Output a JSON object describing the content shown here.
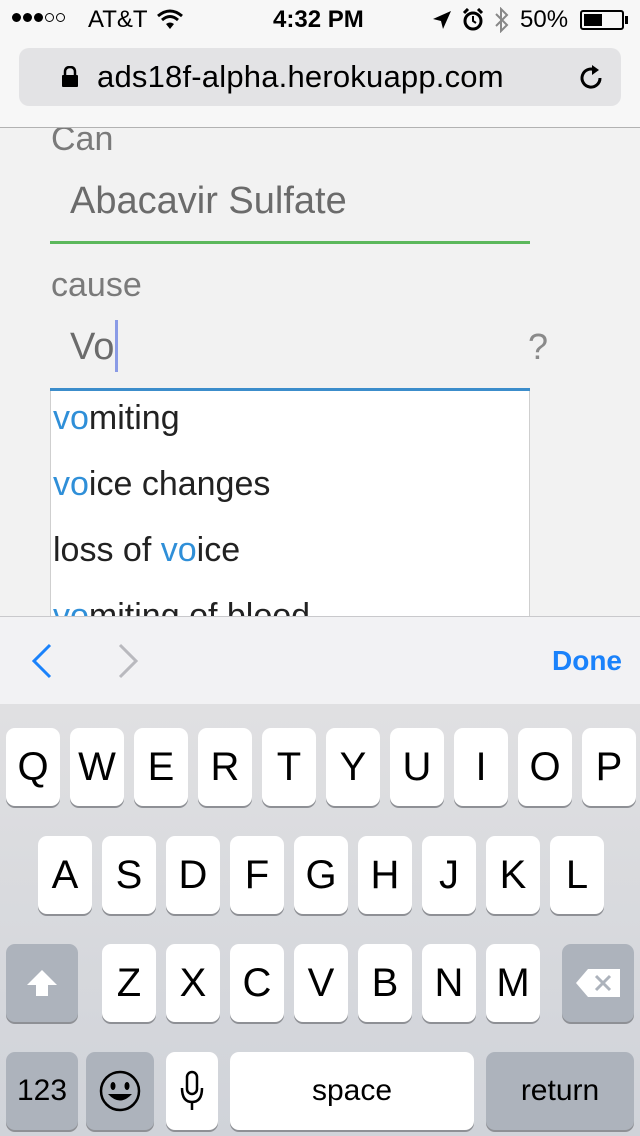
{
  "status_bar": {
    "carrier": "AT&T",
    "time": "4:32 PM",
    "battery": "50%",
    "battery_level": 0.5
  },
  "browser": {
    "url": "ads18f-alpha.herokuapp.com"
  },
  "form": {
    "drug_label": "Can",
    "drug_value": "Abacavir Sulfate",
    "cause_label": "cause",
    "cause_value": "Vo",
    "help_mark": "?"
  },
  "suggestions": [
    {
      "before": "",
      "match": "vo",
      "after": "miting"
    },
    {
      "before": "",
      "match": "vo",
      "after": "ice changes"
    },
    {
      "before": "loss of ",
      "match": "vo",
      "after": "ice"
    },
    {
      "before": "",
      "match": "vo",
      "after": "miting of blood"
    }
  ],
  "accessory_bar": {
    "done_label": "Done"
  },
  "keyboard": {
    "row1": [
      "Q",
      "W",
      "E",
      "R",
      "T",
      "Y",
      "U",
      "I",
      "O",
      "P"
    ],
    "row2": [
      "A",
      "S",
      "D",
      "F",
      "G",
      "H",
      "J",
      "K",
      "L"
    ],
    "row3": [
      "Z",
      "X",
      "C",
      "V",
      "B",
      "N",
      "M"
    ],
    "numbers_label": "123",
    "space_label": "space",
    "return_label": "return"
  },
  "colors": {
    "accent": "#1a82fb",
    "valid_underline": "#5cb85c",
    "active_underline": "#3c8dcb",
    "match_highlight": "#2f8fd8"
  }
}
